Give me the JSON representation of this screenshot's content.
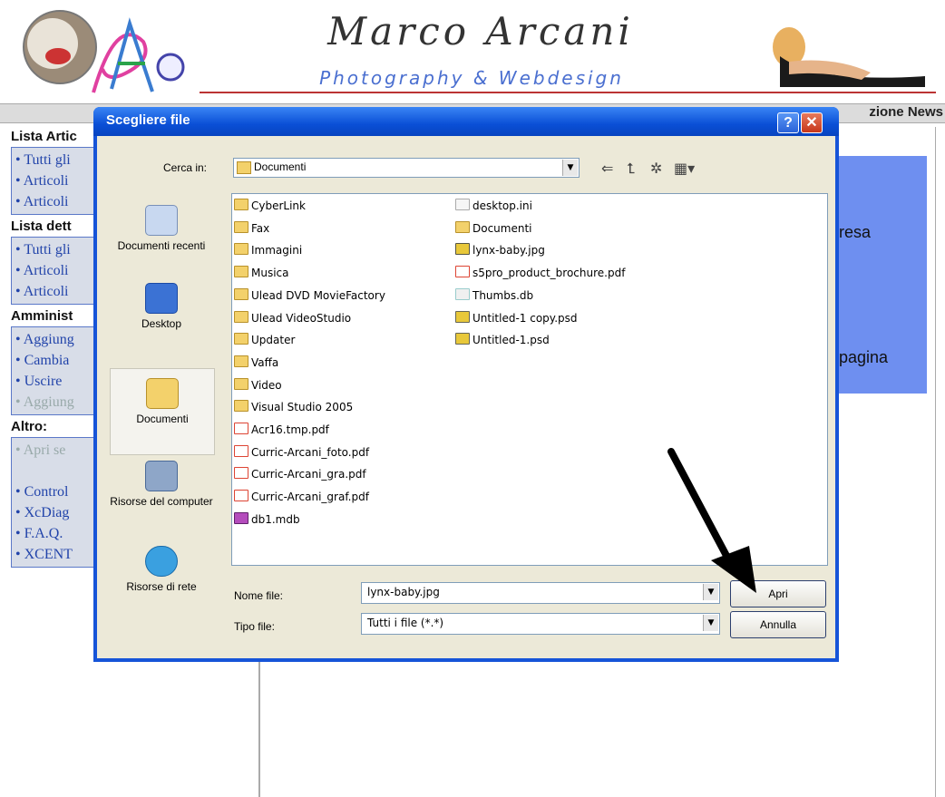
{
  "header": {
    "title": "Marco Arcani",
    "subtitle": "Photography & Webdesign"
  },
  "topbar": {
    "right_label": "zione News"
  },
  "sidebar": {
    "sections": [
      {
        "heading": "Lista Artic",
        "items": [
          "Tutti gli",
          "Articoli",
          "Articoli"
        ]
      },
      {
        "heading": "Lista dett",
        "items": [
          "Tutti gli",
          "Articoli",
          "Articoli"
        ]
      },
      {
        "heading": "Amminist",
        "items": [
          "Aggiung",
          "Cambia",
          "Uscire",
          "Aggiung"
        ]
      },
      {
        "heading": "Altro:",
        "items": [
          "Apri se",
          "Control",
          "XcDiag",
          "F.A.Q.",
          "XCENT"
        ]
      }
    ]
  },
  "blue_box": {
    "line1": "resa",
    "line2": "pagina"
  },
  "dialog": {
    "title": "Scegliere file",
    "help_label": "?",
    "close_label": "✕",
    "look_in_label": "Cerca in:",
    "look_in_value": "Documenti",
    "places": [
      "Documenti recenti",
      "Desktop",
      "Documenti",
      "Risorse del computer",
      "Risorse di rete"
    ],
    "files_col1": [
      {
        "name": "CyberLink",
        "type": "folder"
      },
      {
        "name": "Fax",
        "type": "folder"
      },
      {
        "name": "Immagini",
        "type": "folder"
      },
      {
        "name": "Musica",
        "type": "folder"
      },
      {
        "name": "Ulead DVD MovieFactory",
        "type": "folder"
      },
      {
        "name": "Ulead VideoStudio",
        "type": "folder"
      },
      {
        "name": "Updater",
        "type": "folder"
      },
      {
        "name": "Vaffa",
        "type": "folder"
      },
      {
        "name": "Video",
        "type": "folder"
      },
      {
        "name": "Visual Studio 2005",
        "type": "folder"
      },
      {
        "name": "Acr16.tmp.pdf",
        "type": "pdf"
      },
      {
        "name": "Curric-Arcani_foto.pdf",
        "type": "pdf"
      },
      {
        "name": "Curric-Arcani_gra.pdf",
        "type": "pdf"
      },
      {
        "name": "Curric-Arcani_graf.pdf",
        "type": "pdf"
      },
      {
        "name": "db1.mdb",
        "type": "mdb"
      }
    ],
    "files_col2": [
      {
        "name": "desktop.ini",
        "type": "ini"
      },
      {
        "name": "Documenti",
        "type": "folder"
      },
      {
        "name": "lynx-baby.jpg",
        "type": "jpg"
      },
      {
        "name": "s5pro_product_brochure.pdf",
        "type": "pdf"
      },
      {
        "name": "Thumbs.db",
        "type": "db"
      },
      {
        "name": "Untitled-1 copy.psd",
        "type": "psd"
      },
      {
        "name": "Untitled-1.psd",
        "type": "psd"
      }
    ],
    "file_name_label": "Nome file:",
    "file_name_value": "lynx-baby.jpg",
    "file_type_label": "Tipo file:",
    "file_type_value": "Tutti i file (*.*)",
    "open_label": "Apri",
    "cancel_label": "Annulla"
  },
  "icons": [
    "back-arrow-icon",
    "up-folder-icon",
    "new-folder-icon",
    "view-menu-icon"
  ]
}
